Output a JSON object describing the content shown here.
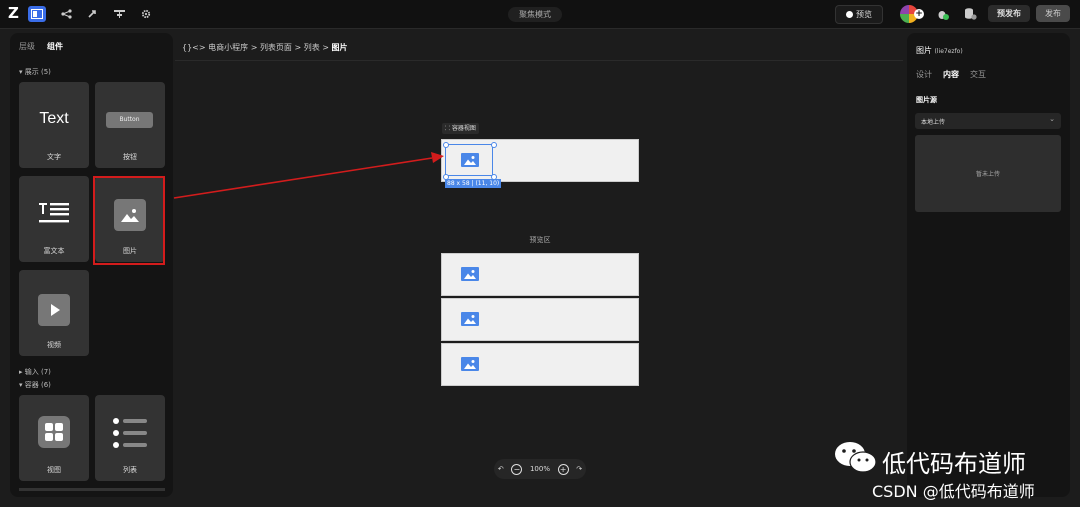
{
  "topbar": {
    "logo": "Z",
    "mode": "聚焦模式",
    "preview": "预览",
    "prepublish": "预发布",
    "publish": "发布"
  },
  "left_panel": {
    "tabs": [
      "层级",
      "组件"
    ],
    "display_section": "展示 (5)",
    "input_section": "输入 (7)",
    "container_section": "容器 (6)",
    "cards": [
      {
        "label": "文字",
        "preview": "Text"
      },
      {
        "label": "按钮",
        "preview": "Button"
      },
      {
        "label": "富文本"
      },
      {
        "label": "图片"
      },
      {
        "label": "视频"
      },
      {
        "label": "视图"
      },
      {
        "label": "列表"
      }
    ]
  },
  "breadcrumb": {
    "prefix": "{}<>",
    "items": [
      "电商小程序",
      "列表页面",
      "列表",
      "图片"
    ],
    "separator": ">"
  },
  "canvas": {
    "container_tag": "容器视图",
    "size_tag": "88 x 58 | (11, 10)",
    "preview_area": "预览区",
    "zoom": "100%"
  },
  "right_panel": {
    "title": "图片",
    "title_id": "(lie7ezfo)",
    "tabs": [
      "设计",
      "内容",
      "交互"
    ],
    "active_tab": "内容",
    "source_label": "图片源",
    "source_value": "本地上传",
    "upload_placeholder": "暂未上传"
  },
  "watermark": {
    "channel": "低代码布道师",
    "csdn": "CSDN @低代码布道师"
  },
  "colors": {
    "accent": "#3a6de8",
    "image_icon": "#4a87e8",
    "highlight": "#d31c1c"
  }
}
